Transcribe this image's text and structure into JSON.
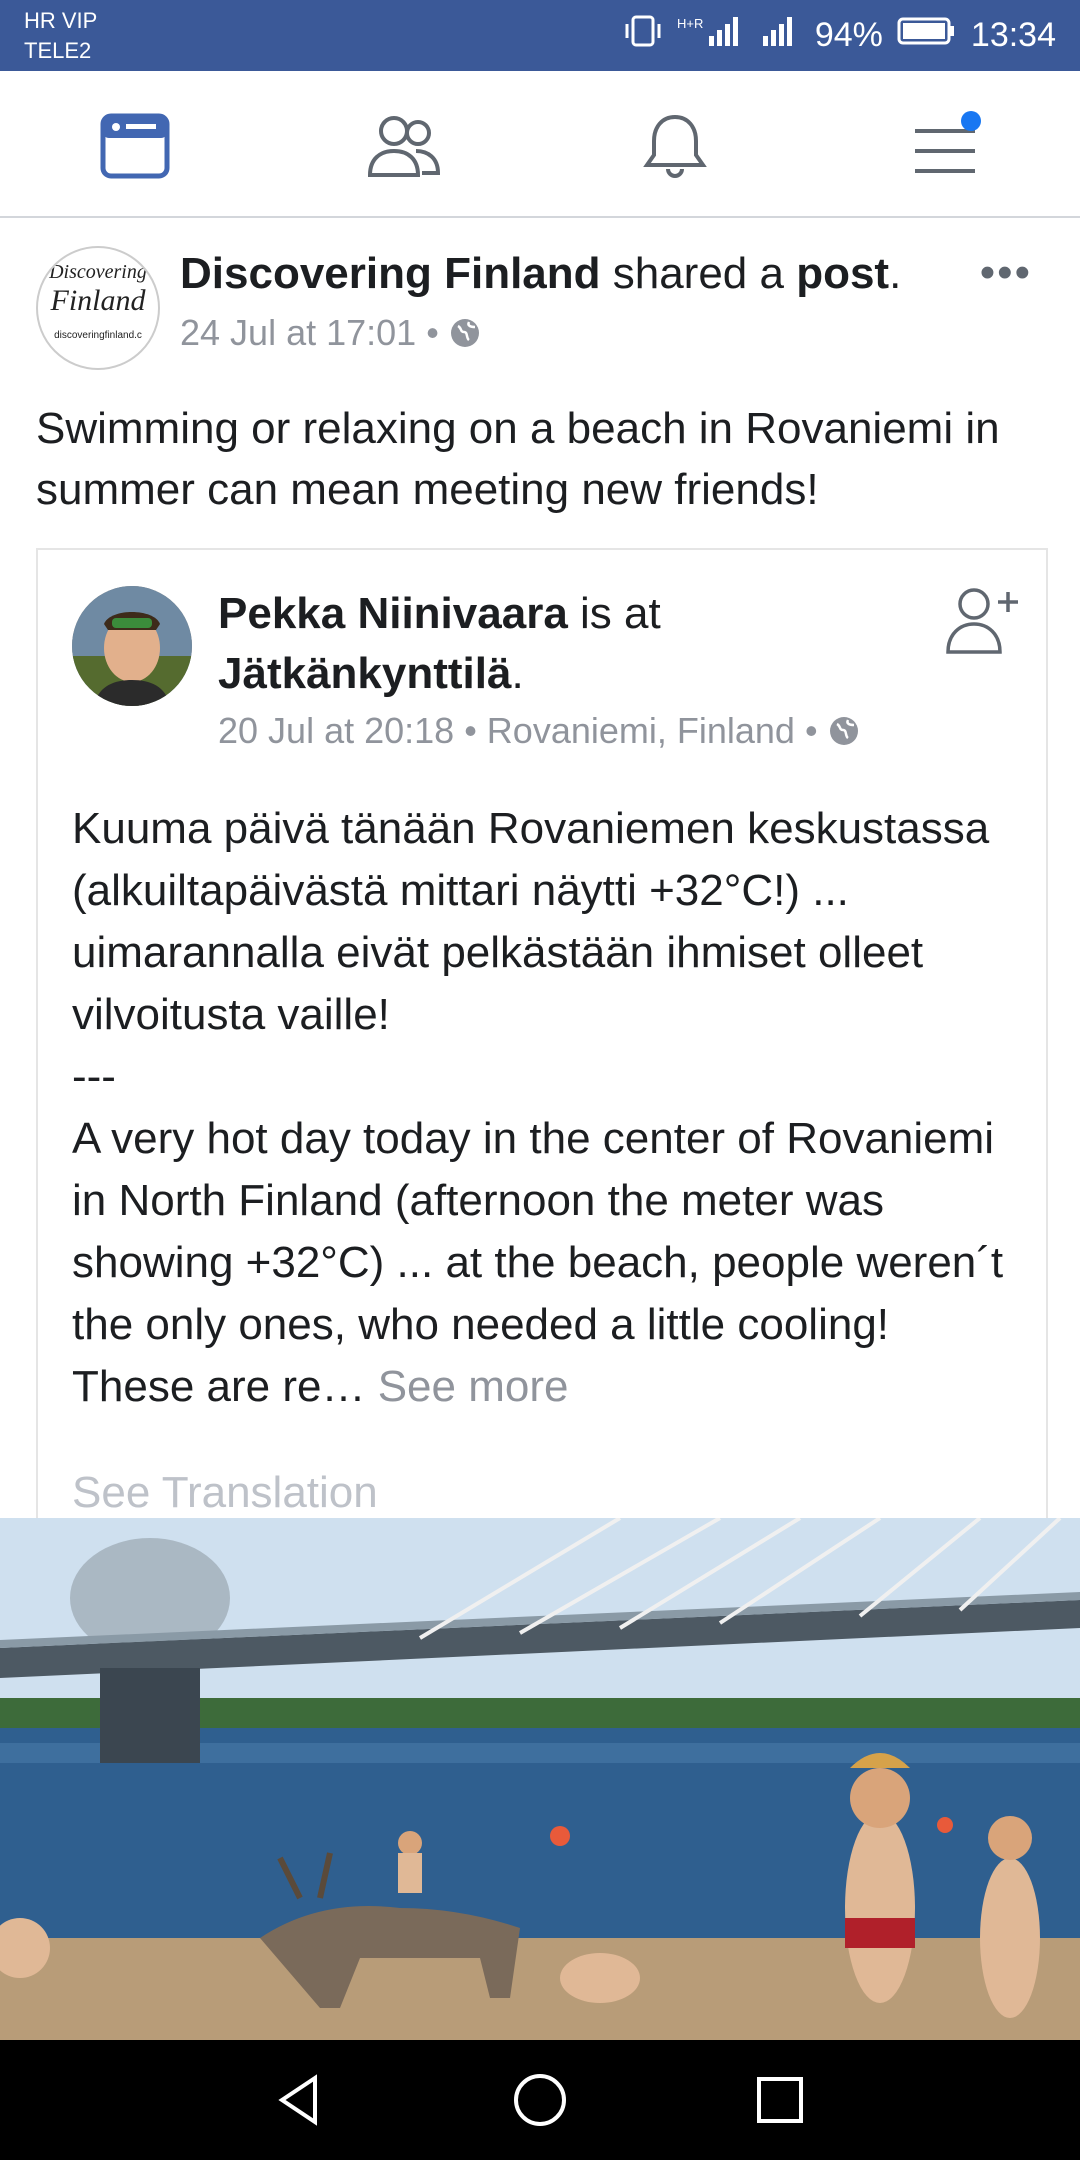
{
  "status_bar": {
    "carrier_line1": "HR VIP",
    "carrier_line2": "TELE2",
    "network": "H+R",
    "battery": "94%",
    "time": "13:34"
  },
  "top_nav": {
    "items": [
      "news-feed-icon",
      "friends-icon",
      "notifications-icon",
      "menu-icon"
    ],
    "active_color": "#4267b2",
    "badge_color": "#1877f2"
  },
  "post": {
    "page_name": "Discovering Finland",
    "action_text": " shared a ",
    "action_object": "post",
    "action_end": ".",
    "timestamp": "24 Jul at 17:01",
    "separator": "•",
    "caption": "Swimming or relaxing on a beach in Rovaniemi in summer can mean meeting new friends!",
    "logo_line1": "Discovering",
    "logo_line2": "Finland",
    "logo_url": "discoveringfinland.c"
  },
  "shared_post": {
    "author": "Pekka Niinivaara",
    "is_at": " is at ",
    "place": "Jätkänkynttilä",
    "place_end": ".",
    "timestamp": "20 Jul at 20:18",
    "location": "Rovaniemi, Finland",
    "separator": "•",
    "text_fi": "Kuuma päivä tänään Rovaniemen keskustassa (alkuiltapäivästä mittari näytti +32°C!) ... uimarannalla eivät pelkästään ihmiset olleet vilvoitusta vaille!",
    "divider": "---",
    "text_en": "A very hot day today in the center of Rovaniemi in North Finland (afternoon the meter was showing +32°C) ... at the beach, people weren´t the only ones, who needed a little cooling! These are re…",
    "see_more": " See more",
    "see_translation": "See Translation"
  },
  "system_nav": [
    "back-icon",
    "home-icon",
    "recents-icon"
  ]
}
